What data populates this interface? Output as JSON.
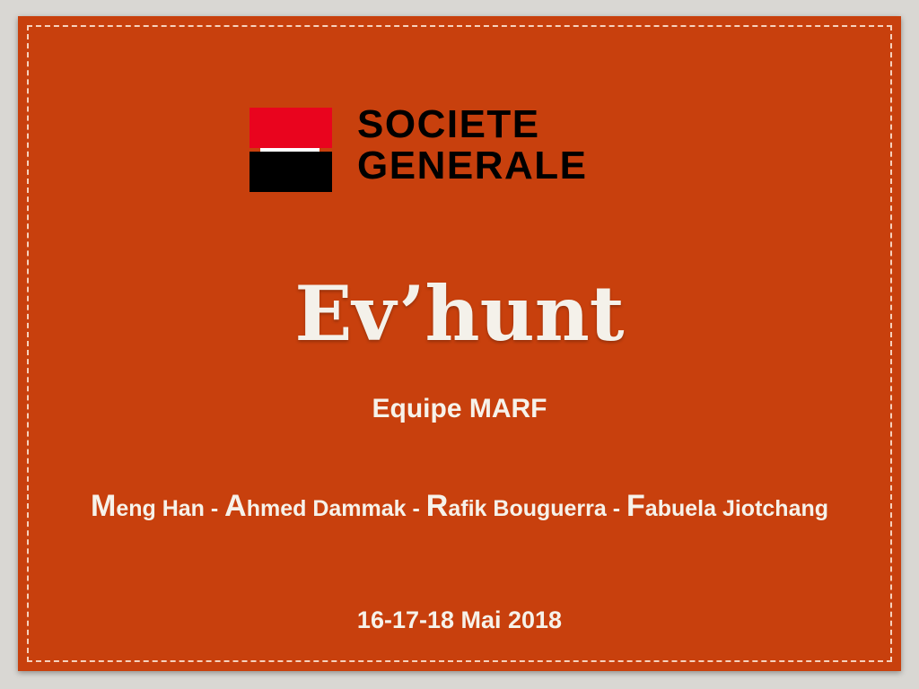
{
  "logo": {
    "line1": "SOCIETE",
    "line2": "GENERALE",
    "colors": {
      "red": "#e9041e",
      "black": "#000000"
    }
  },
  "title": "Ev’hunt",
  "subtitle": "Equipe MARF",
  "members": [
    {
      "initial": "M",
      "rest": "eng Han"
    },
    {
      "initial": "A",
      "rest": "hmed Dammak"
    },
    {
      "initial": "R",
      "rest": "afik Bouguerra"
    },
    {
      "initial": "F",
      "rest": "abuela Jiotchang"
    }
  ],
  "separator": " - ",
  "date": "16-17-18 Mai 2018",
  "colors": {
    "slide_background": "#c8400d",
    "text": "#f6f2ea"
  }
}
